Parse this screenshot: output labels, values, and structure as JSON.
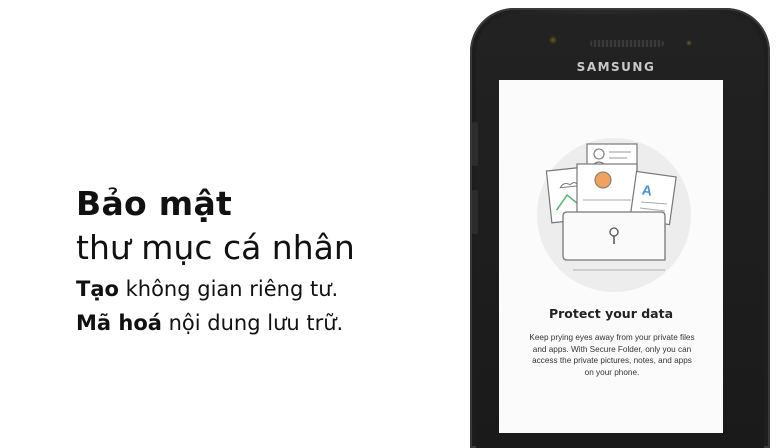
{
  "headline": {
    "title_bold": "Bảo mật",
    "title_regular": "thư mục cá nhân",
    "line1_bold": "Tạo",
    "line1_rest": " không gian riêng tư.",
    "line2_bold": "Mã hoá",
    "line2_rest": " nội dung lưu trữ."
  },
  "phone": {
    "brand": "SAMSUNG",
    "screen": {
      "title": "Protect your data",
      "description": "Keep prying eyes away from your private files and apps. With Secure Folder, only you can access the private pictures, notes, and apps on your phone."
    }
  },
  "colors": {
    "accent_orange": "#f0a35e",
    "accent_blue": "#4a90d9",
    "accent_green": "#57b56b"
  }
}
